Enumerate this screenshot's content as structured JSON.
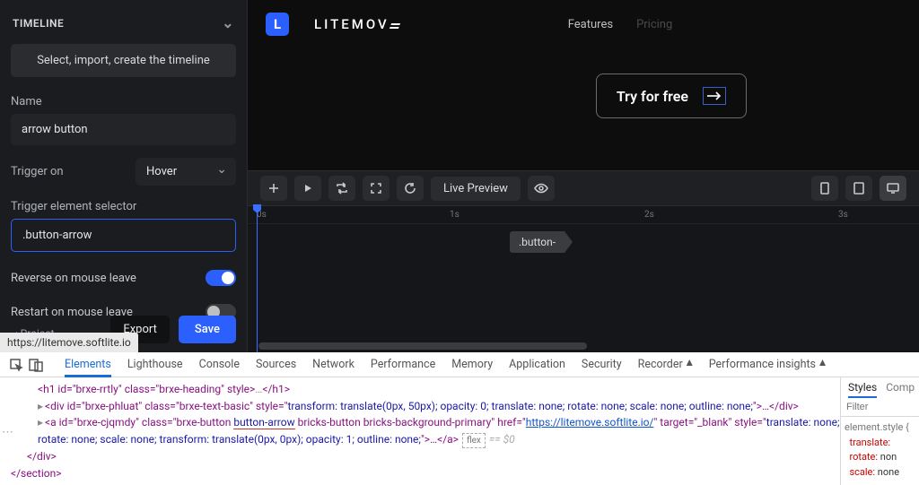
{
  "sidebar": {
    "title": "TIMELINE",
    "create_btn": "Select, import, create the timeline",
    "name_label": "Name",
    "name_value": "arrow button",
    "trigger_label": "Trigger on",
    "trigger_value": "Hover",
    "selector_label": "Trigger element selector",
    "selector_value": ".button-arrow",
    "reverse_label": "Reverse on mouse leave",
    "restart_label": "Restart on mouse leave",
    "project_label": "‹  Project",
    "export": "Export",
    "save": "Save",
    "url_hint": "https://litemove.softlite.io"
  },
  "canvas": {
    "brand": "LITEMOV",
    "nav": {
      "features": "Features",
      "pricing": "Pricing"
    },
    "cta": "Try for free",
    "toolbar": {
      "live_preview": "Live Preview"
    },
    "ruler": [
      "0s",
      "1s",
      "2s",
      "3s"
    ],
    "tag": ".button-"
  },
  "devtools": {
    "tabs": [
      "Elements",
      "Lighthouse",
      "Console",
      "Sources",
      "Network",
      "Performance",
      "Memory",
      "Application",
      "Security",
      "Recorder",
      "Performance insights"
    ],
    "right_tabs": [
      "Styles",
      "Comp"
    ],
    "filter_placeholder": "Filter",
    "dom": {
      "line1_pre": "<h1 id=\"brxe-rrtly\" class=\"brxe-heading\" style>",
      "line1_post": "</h1>",
      "div_open": "<div id=\"brxe-phluat\" class=\"brxe-text-basic\" style=\"",
      "div_style": "transform: translate(0px, 50px); opacity: 0; translate: none; rotate: none; scale: none; outline: none;",
      "div_close": "\">…</div>",
      "a_open1": "<a id=\"brxe-cjqmdy\" class=\"brxe-button ",
      "a_underlined": "button-arrow",
      "a_open2": " bricks-button bricks-background-primary\" href=\"",
      "a_href": "https://litemove.softlite.io/",
      "a_open3": "\" target=\"_blank\" style=\"",
      "a_style": "translate: none; rotate: none; scale: none; transform: translate(0px, 0px); opacity: 1; outline: none;",
      "a_close": "\">…</a>",
      "eq0": "== $0",
      "end_div": "</div>",
      "end_section": "</section>"
    },
    "styles": {
      "header": "element.style {",
      "p1": "translate:",
      "p2": "rotate:",
      "v2": "non",
      "p3": "scale:",
      "v3": "none"
    }
  }
}
